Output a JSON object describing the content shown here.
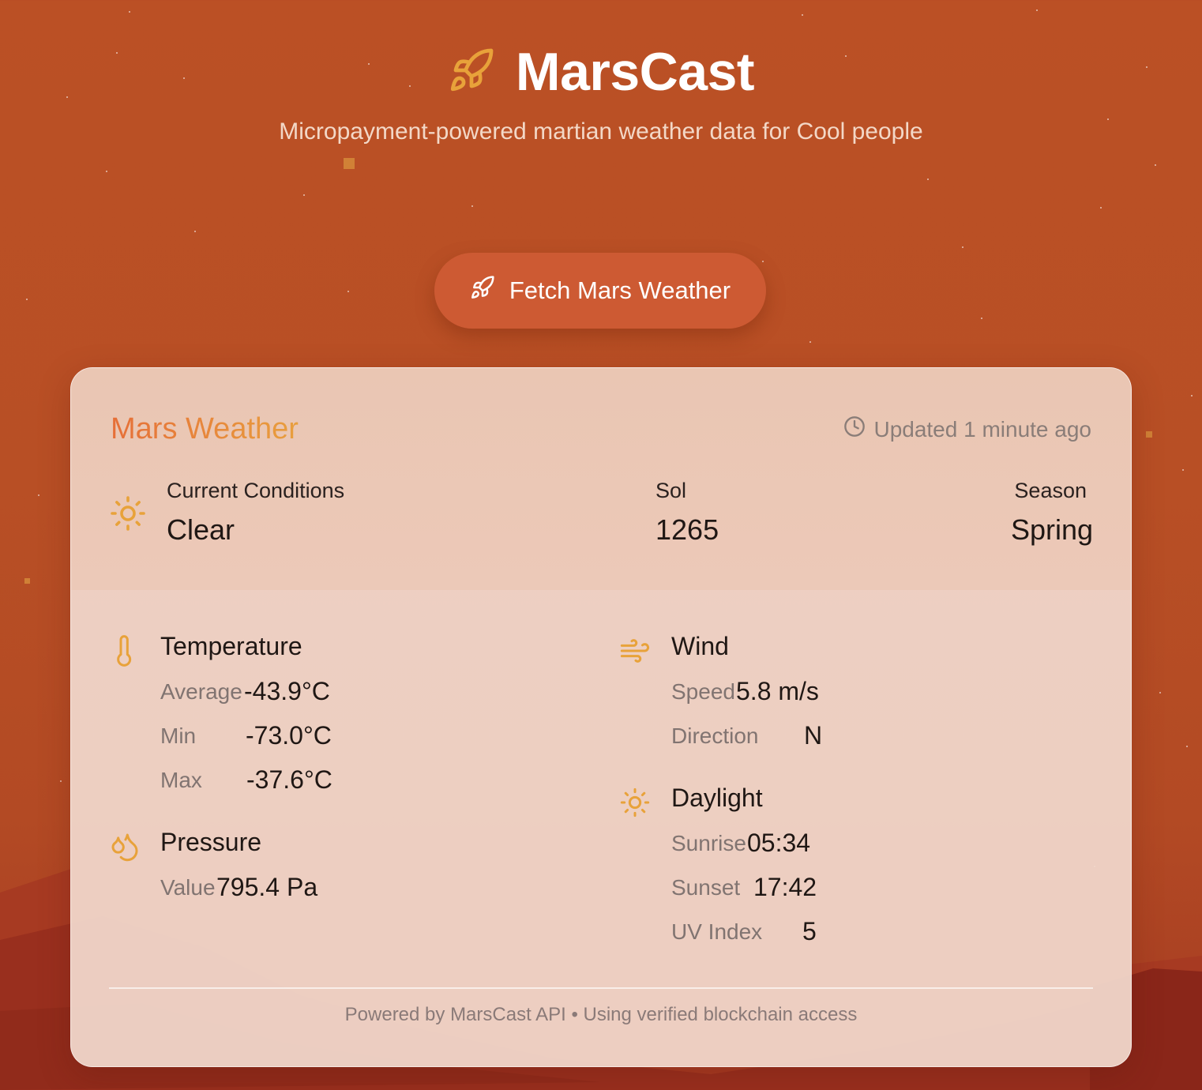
{
  "header": {
    "app_title": "MarsCast",
    "subtitle": "Micropayment-powered martian weather data for Cool people",
    "logo_icon": "rocket-icon",
    "accent_color": "#e8a23a"
  },
  "fetch_button": {
    "label": "Fetch Mars Weather",
    "icon": "rocket-icon",
    "color": "#cd5a33"
  },
  "card": {
    "title": "Mars Weather",
    "updated": "Updated 1 minute ago",
    "conditions": {
      "label": "Current Conditions",
      "value": "Clear"
    },
    "sol": {
      "label": "Sol",
      "value": "1265"
    },
    "season": {
      "label": "Season",
      "value": "Spring"
    },
    "temperature": {
      "title": "Temperature",
      "rows": [
        {
          "label": "Average",
          "value": "-43.9°C"
        },
        {
          "label": "Min",
          "value": "-73.0°C"
        },
        {
          "label": "Max",
          "value": "-37.6°C"
        }
      ]
    },
    "pressure": {
      "title": "Pressure",
      "rows": [
        {
          "label": "Value",
          "value": "795.4 Pa"
        }
      ]
    },
    "wind": {
      "title": "Wind",
      "rows": [
        {
          "label": "Speed",
          "value": "5.8 m/s"
        },
        {
          "label": "Direction",
          "value": "N"
        }
      ]
    },
    "daylight": {
      "title": "Daylight",
      "rows": [
        {
          "label": "Sunrise",
          "value": "05:34"
        },
        {
          "label": "Sunset",
          "value": "17:42"
        },
        {
          "label": "UV Index",
          "value": "5"
        }
      ]
    },
    "footer": "Powered by MarsCast API • Using verified blockchain access"
  }
}
